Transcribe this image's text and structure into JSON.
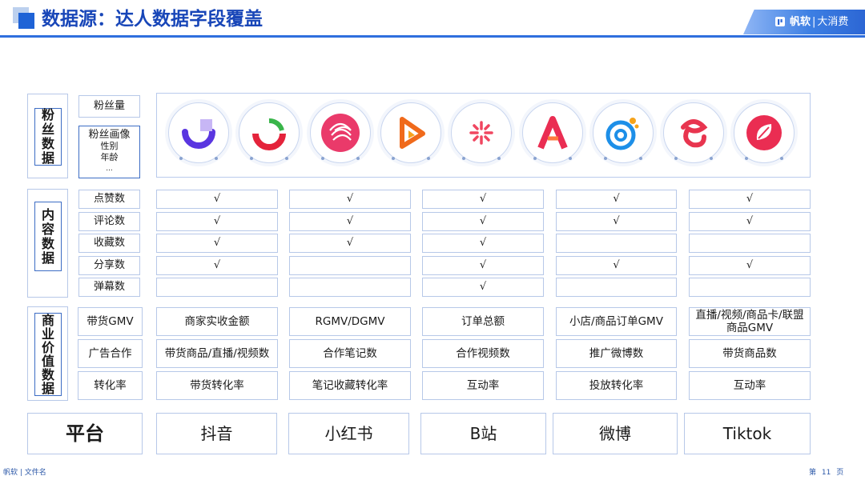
{
  "header": {
    "title": "数据源：达人数据字段覆盖",
    "logo": {
      "brand": "帆软",
      "separator": "|",
      "sub": "大消费"
    }
  },
  "colors": {
    "accent": "#1f63d6",
    "title": "#1846b8",
    "border": "#b7c8e8"
  },
  "sections": {
    "fans": {
      "label": "粉丝数据",
      "rows": [
        {
          "label": "粉丝量"
        },
        {
          "label": "粉丝画像",
          "sub": [
            "性别",
            "年龄",
            "..."
          ]
        }
      ]
    },
    "content": {
      "label": "内容数据",
      "rows": [
        "点赞数",
        "评论数",
        "收藏数",
        "分享数",
        "弹幕数"
      ]
    },
    "commercial": {
      "label": "商业价值数据",
      "rows": [
        "带货GMV",
        "广告合作",
        "转化率"
      ]
    }
  },
  "logos": [
    {
      "icon": "arc-logo-icon"
    },
    {
      "icon": "semicircle-logo-icon"
    },
    {
      "icon": "swirl-logo-icon"
    },
    {
      "icon": "play-logo-icon"
    },
    {
      "icon": "sparkle-logo-icon"
    },
    {
      "icon": "letter-a-logo-icon"
    },
    {
      "icon": "at-sign-logo-icon"
    },
    {
      "icon": "knot-logo-icon"
    },
    {
      "icon": "leaf-logo-icon"
    }
  ],
  "content_matrix": [
    [
      "√",
      "√",
      "√",
      "√",
      "√"
    ],
    [
      "√",
      "√",
      "√",
      "√",
      "√"
    ],
    [
      "√",
      "√",
      "√",
      "",
      ""
    ],
    [
      "√",
      "",
      "√",
      "√",
      "√"
    ],
    [
      "",
      "",
      "√",
      "",
      ""
    ]
  ],
  "commercial_matrix": [
    [
      "商家实收金额",
      "RGMV/DGMV",
      "订单总额",
      "小店/商品订单GMV",
      "直播/视频/商品卡/联盟商品GMV"
    ],
    [
      "带货商品/直播/视频数",
      "合作笔记数",
      "合作视频数",
      "推广微博数",
      "带货商品数"
    ],
    [
      "带货转化率",
      "笔记收藏转化率",
      "互动率",
      "投放转化率",
      "互动率"
    ]
  ],
  "platform_row": {
    "label": "平台",
    "platforms": [
      "抖音",
      "小红书",
      "B站",
      "微博",
      "Tiktok"
    ]
  },
  "footer": {
    "left": "帆软 | 文件名",
    "page_prefix": "第",
    "page_number": "11",
    "page_suffix": "页"
  }
}
